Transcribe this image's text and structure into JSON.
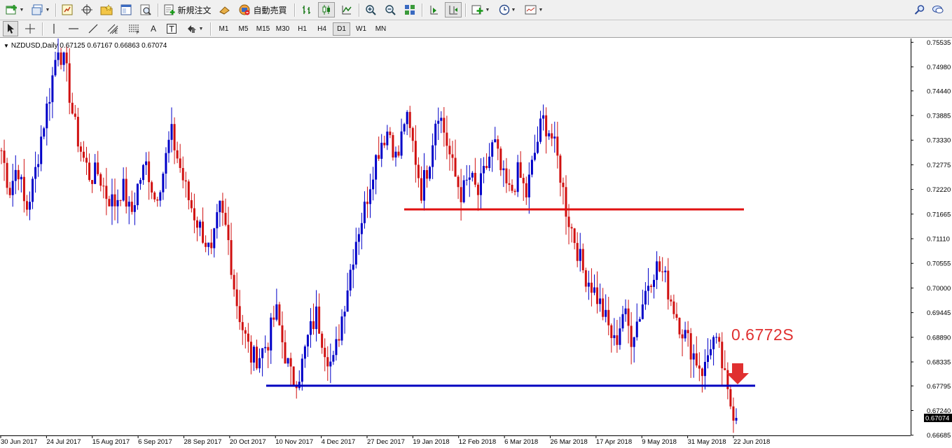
{
  "toolbar": {
    "new_order_label": "新規注文",
    "auto_trade_label": "自動売買"
  },
  "timeframes": [
    {
      "label": "M1",
      "active": false
    },
    {
      "label": "M5",
      "active": false
    },
    {
      "label": "M15",
      "active": false
    },
    {
      "label": "M30",
      "active": false
    },
    {
      "label": "H1",
      "active": false
    },
    {
      "label": "H4",
      "active": false
    },
    {
      "label": "D1",
      "active": true
    },
    {
      "label": "W1",
      "active": false
    },
    {
      "label": "MN",
      "active": false
    }
  ],
  "chart": {
    "symbol_info": "NZDUSD,Daily  0.67125 0.67167 0.66863 0.67074",
    "current_price": "0.67074",
    "annotation": "0.6772S",
    "colors": {
      "bull": "#0000c8",
      "bear": "#d01010",
      "resistance_line": "#e01010",
      "support_line": "#0000c0",
      "arrow": "#e03030"
    }
  },
  "chart_data": {
    "type": "candlestick",
    "title": "NZDUSD,Daily",
    "ohlc_header": {
      "open": 0.67125,
      "high": 0.67167,
      "low": 0.66863,
      "close": 0.67074
    },
    "y_ticks": [
      "0.75535",
      "0.74980",
      "0.74440",
      "0.73885",
      "0.73330",
      "0.72775",
      "0.72220",
      "0.71665",
      "0.71110",
      "0.70555",
      "0.70000",
      "0.69445",
      "0.68890",
      "0.68335",
      "0.67795",
      "0.67240",
      "0.66685"
    ],
    "ylim": [
      0.6668,
      0.7562
    ],
    "x_ticks": [
      "30 Jun 2017",
      "24 Jul 2017",
      "15 Aug 2017",
      "6 Sep 2017",
      "28 Sep 2017",
      "20 Oct 2017",
      "10 Nov 2017",
      "4 Dec 2017",
      "27 Dec 2017",
      "19 Jan 2018",
      "12 Feb 2018",
      "6 Mar 2018",
      "26 Mar 2018",
      "17 Apr 2018",
      "9 May 2018",
      "31 May 2018",
      "22 Jun 2018"
    ],
    "horizontal_lines": [
      {
        "name": "resistance",
        "value": 0.7177,
        "from": "11 Jan 2018",
        "to": "12 Jul 2018"
      },
      {
        "name": "support",
        "value": 0.678,
        "from": "10 Nov 2017",
        "to": "12 Jul 2018"
      }
    ],
    "path_points": [
      0.731,
      0.722,
      0.728,
      0.717,
      0.724,
      0.735,
      0.744,
      0.755,
      0.749,
      0.737,
      0.73,
      0.725,
      0.726,
      0.721,
      0.719,
      0.723,
      0.716,
      0.724,
      0.728,
      0.72,
      0.726,
      0.735,
      0.728,
      0.721,
      0.716,
      0.712,
      0.707,
      0.718,
      0.712,
      0.698,
      0.69,
      0.684,
      0.685,
      0.688,
      0.695,
      0.686,
      0.679,
      0.681,
      0.689,
      0.694,
      0.687,
      0.682,
      0.692,
      0.702,
      0.712,
      0.718,
      0.727,
      0.733,
      0.736,
      0.728,
      0.739,
      0.732,
      0.722,
      0.729,
      0.741,
      0.734,
      0.726,
      0.721,
      0.725,
      0.721,
      0.727,
      0.733,
      0.725,
      0.721,
      0.726,
      0.721,
      0.73,
      0.738,
      0.735,
      0.728,
      0.717,
      0.711,
      0.704,
      0.701,
      0.697,
      0.692,
      0.687,
      0.695,
      0.689,
      0.694,
      0.701,
      0.705,
      0.703,
      0.697,
      0.692,
      0.688,
      0.684,
      0.681,
      0.689,
      0.685,
      0.675,
      0.671
    ],
    "current_price": 0.67074
  }
}
